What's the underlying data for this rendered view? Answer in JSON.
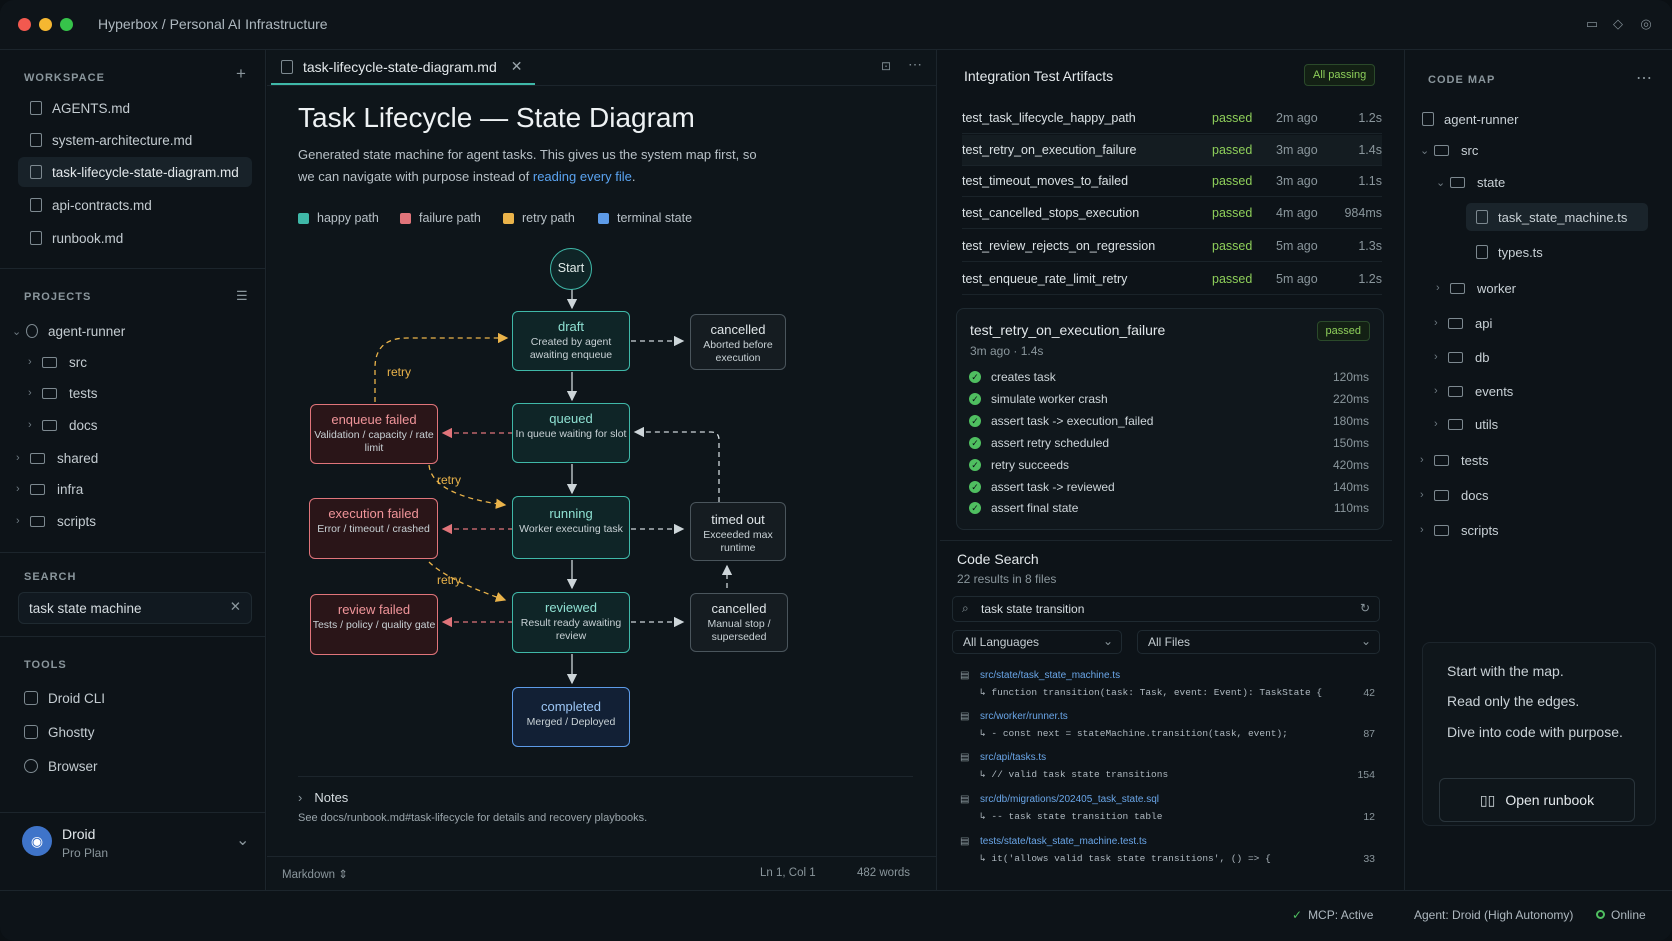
{
  "window": {
    "title": "Hyperbox / Personal AI Infrastructure"
  },
  "sidebar": {
    "workspace_header": "WORKSPACE",
    "files": [
      "AGENTS.md",
      "system-architecture.md",
      "task-lifecycle-state-diagram.md",
      "api-contracts.md",
      "runbook.md"
    ],
    "projects_header": "PROJECTS",
    "projects": [
      "agent-runner",
      "src",
      "tests",
      "docs",
      "shared",
      "infra",
      "scripts"
    ],
    "search_header": "SEARCH",
    "search_value": "task state machine",
    "tools_header": "TOOLS",
    "tools": [
      "Droid CLI",
      "Ghostty",
      "Browser"
    ],
    "user": {
      "name": "Droid",
      "plan": "Pro Plan"
    }
  },
  "editor": {
    "tab": "task-lifecycle-state-diagram.md",
    "title": "Task Lifecycle — State Diagram",
    "intro": "Generated state machine for agent tasks. This gives us the system map first, so we can navigate with purpose instead of ",
    "intro_link": "reading every file",
    "intro_end": ".",
    "legend": [
      "happy path",
      "failure path",
      "retry path",
      "terminal state"
    ],
    "diagram": {
      "start": "Start",
      "draft": {
        "t": "draft",
        "d": "Created by agent awaiting enqueue"
      },
      "cancelled1": {
        "t": "cancelled",
        "d": "Aborted before execution"
      },
      "queued": {
        "t": "queued",
        "d": "In queue waiting for slot"
      },
      "enqueue_failed": {
        "t": "enqueue failed",
        "d": "Validation / capacity / rate limit"
      },
      "running": {
        "t": "running",
        "d": "Worker executing task"
      },
      "execution_failed": {
        "t": "execution failed",
        "d": "Error / timeout / crashed"
      },
      "timed_out": {
        "t": "timed out",
        "d": "Exceeded max runtime"
      },
      "reviewed": {
        "t": "reviewed",
        "d": "Result ready awaiting review"
      },
      "review_failed": {
        "t": "review failed",
        "d": "Tests / policy / quality gate"
      },
      "cancelled2": {
        "t": "cancelled",
        "d": "Manual stop / superseded"
      },
      "completed": {
        "t": "completed",
        "d": "Merged / Deployed"
      },
      "retry": "retry"
    },
    "notes_title": "Notes",
    "notes_text": "See docs/runbook.md#task-lifecycle for details and recovery playbooks.",
    "status": {
      "mode": "Markdown",
      "pos": "Ln 1, Col 1",
      "words": "482 words"
    }
  },
  "tests": {
    "title": "Integration Test Artifacts",
    "badge": "All passing",
    "rows": [
      {
        "n": "test_task_lifecycle_happy_path",
        "s": "passed",
        "a": "2m ago",
        "d": "1.2s"
      },
      {
        "n": "test_retry_on_execution_failure",
        "s": "passed",
        "a": "3m ago",
        "d": "1.4s"
      },
      {
        "n": "test_timeout_moves_to_failed",
        "s": "passed",
        "a": "3m ago",
        "d": "1.1s"
      },
      {
        "n": "test_cancelled_stops_execution",
        "s": "passed",
        "a": "4m ago",
        "d": "984ms"
      },
      {
        "n": "test_review_rejects_on_regression",
        "s": "passed",
        "a": "5m ago",
        "d": "1.3s"
      },
      {
        "n": "test_enqueue_rate_limit_retry",
        "s": "passed",
        "a": "5m ago",
        "d": "1.2s"
      }
    ],
    "detail": {
      "name": "test_retry_on_execution_failure",
      "badge": "passed",
      "meta": "3m ago  ·  1.4s",
      "steps": [
        {
          "n": "creates task",
          "ms": "120ms"
        },
        {
          "n": "simulate worker crash",
          "ms": "220ms"
        },
        {
          "n": "assert task -> execution_failed",
          "ms": "180ms"
        },
        {
          "n": "assert retry scheduled",
          "ms": "150ms"
        },
        {
          "n": "retry succeeds",
          "ms": "420ms"
        },
        {
          "n": "assert task -> reviewed",
          "ms": "140ms"
        },
        {
          "n": "assert final state",
          "ms": "110ms"
        }
      ]
    }
  },
  "code_search": {
    "title": "Code Search",
    "count": "22 results in 8 files",
    "query": "task state transition",
    "lang": "All Languages",
    "files": "All Files",
    "results": [
      {
        "p": "src/state/task_state_machine.ts",
        "c": "↳ function transition(task: Task, event: Event): TaskState {",
        "l": "42"
      },
      {
        "p": "src/worker/runner.ts",
        "c": "↳ - const next = stateMachine.transition(task, event);",
        "l": "87"
      },
      {
        "p": "src/api/tasks.ts",
        "c": "↳ // valid task state transitions",
        "l": "154"
      },
      {
        "p": "src/db/migrations/202405_task_state.sql",
        "c": "↳ -- task state transition table",
        "l": "12"
      },
      {
        "p": "tests/state/task_state_machine.test.ts",
        "c": "↳ it('allows valid task state transitions', () => {",
        "l": "33"
      }
    ]
  },
  "code_map": {
    "title": "CODE MAP",
    "items": [
      "agent-runner",
      "src",
      "state",
      "task_state_machine.ts",
      "types.ts",
      "worker",
      "api",
      "db",
      "events",
      "utils",
      "tests",
      "docs",
      "scripts"
    ],
    "quote": [
      "Start with the map.",
      "Read only the edges.",
      "Dive into code with purpose."
    ],
    "button": "Open runbook"
  },
  "statusbar": {
    "mcp": "MCP: Active",
    "agent": "Agent: Droid (High Autonomy)",
    "online": "Online"
  }
}
